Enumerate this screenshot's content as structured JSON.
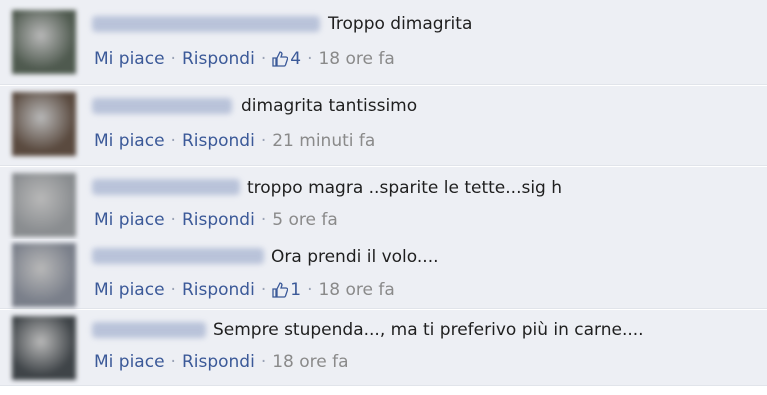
{
  "comments": [
    {
      "text": "Troppo dimagrita",
      "like_label": "Mi piace",
      "reply_label": "Rispondi",
      "likes": "4",
      "time": "18 ore fa",
      "avatar_color": "#4f5a4f"
    },
    {
      "text": "dimagrita tantissimo",
      "like_label": "Mi piace",
      "reply_label": "Rispondi",
      "likes": null,
      "time": "21 minuti fa",
      "avatar_color": "#5a4a3f"
    },
    {
      "text": "troppo magra ..sparite le tette...sig h",
      "like_label": "Mi piace",
      "reply_label": "Rispondi",
      "likes": null,
      "time": "5 ore fa",
      "avatar_color": "#8a8d90"
    },
    {
      "text": "Ora prendi il volo....",
      "like_label": "Mi piace",
      "reply_label": "Rispondi",
      "likes": "1",
      "time": "18 ore fa",
      "avatar_color": "#7a7f8a"
    },
    {
      "text": "Sempre stupenda..., ma ti preferivo più in carne....",
      "like_label": "Mi piace",
      "reply_label": "Rispondi",
      "likes": null,
      "time": "18 ore fa",
      "avatar_color": "#3f4448"
    }
  ],
  "colors": {
    "link": "#3b5998",
    "background": "#edeff4",
    "meta": "#8a8a8a"
  }
}
